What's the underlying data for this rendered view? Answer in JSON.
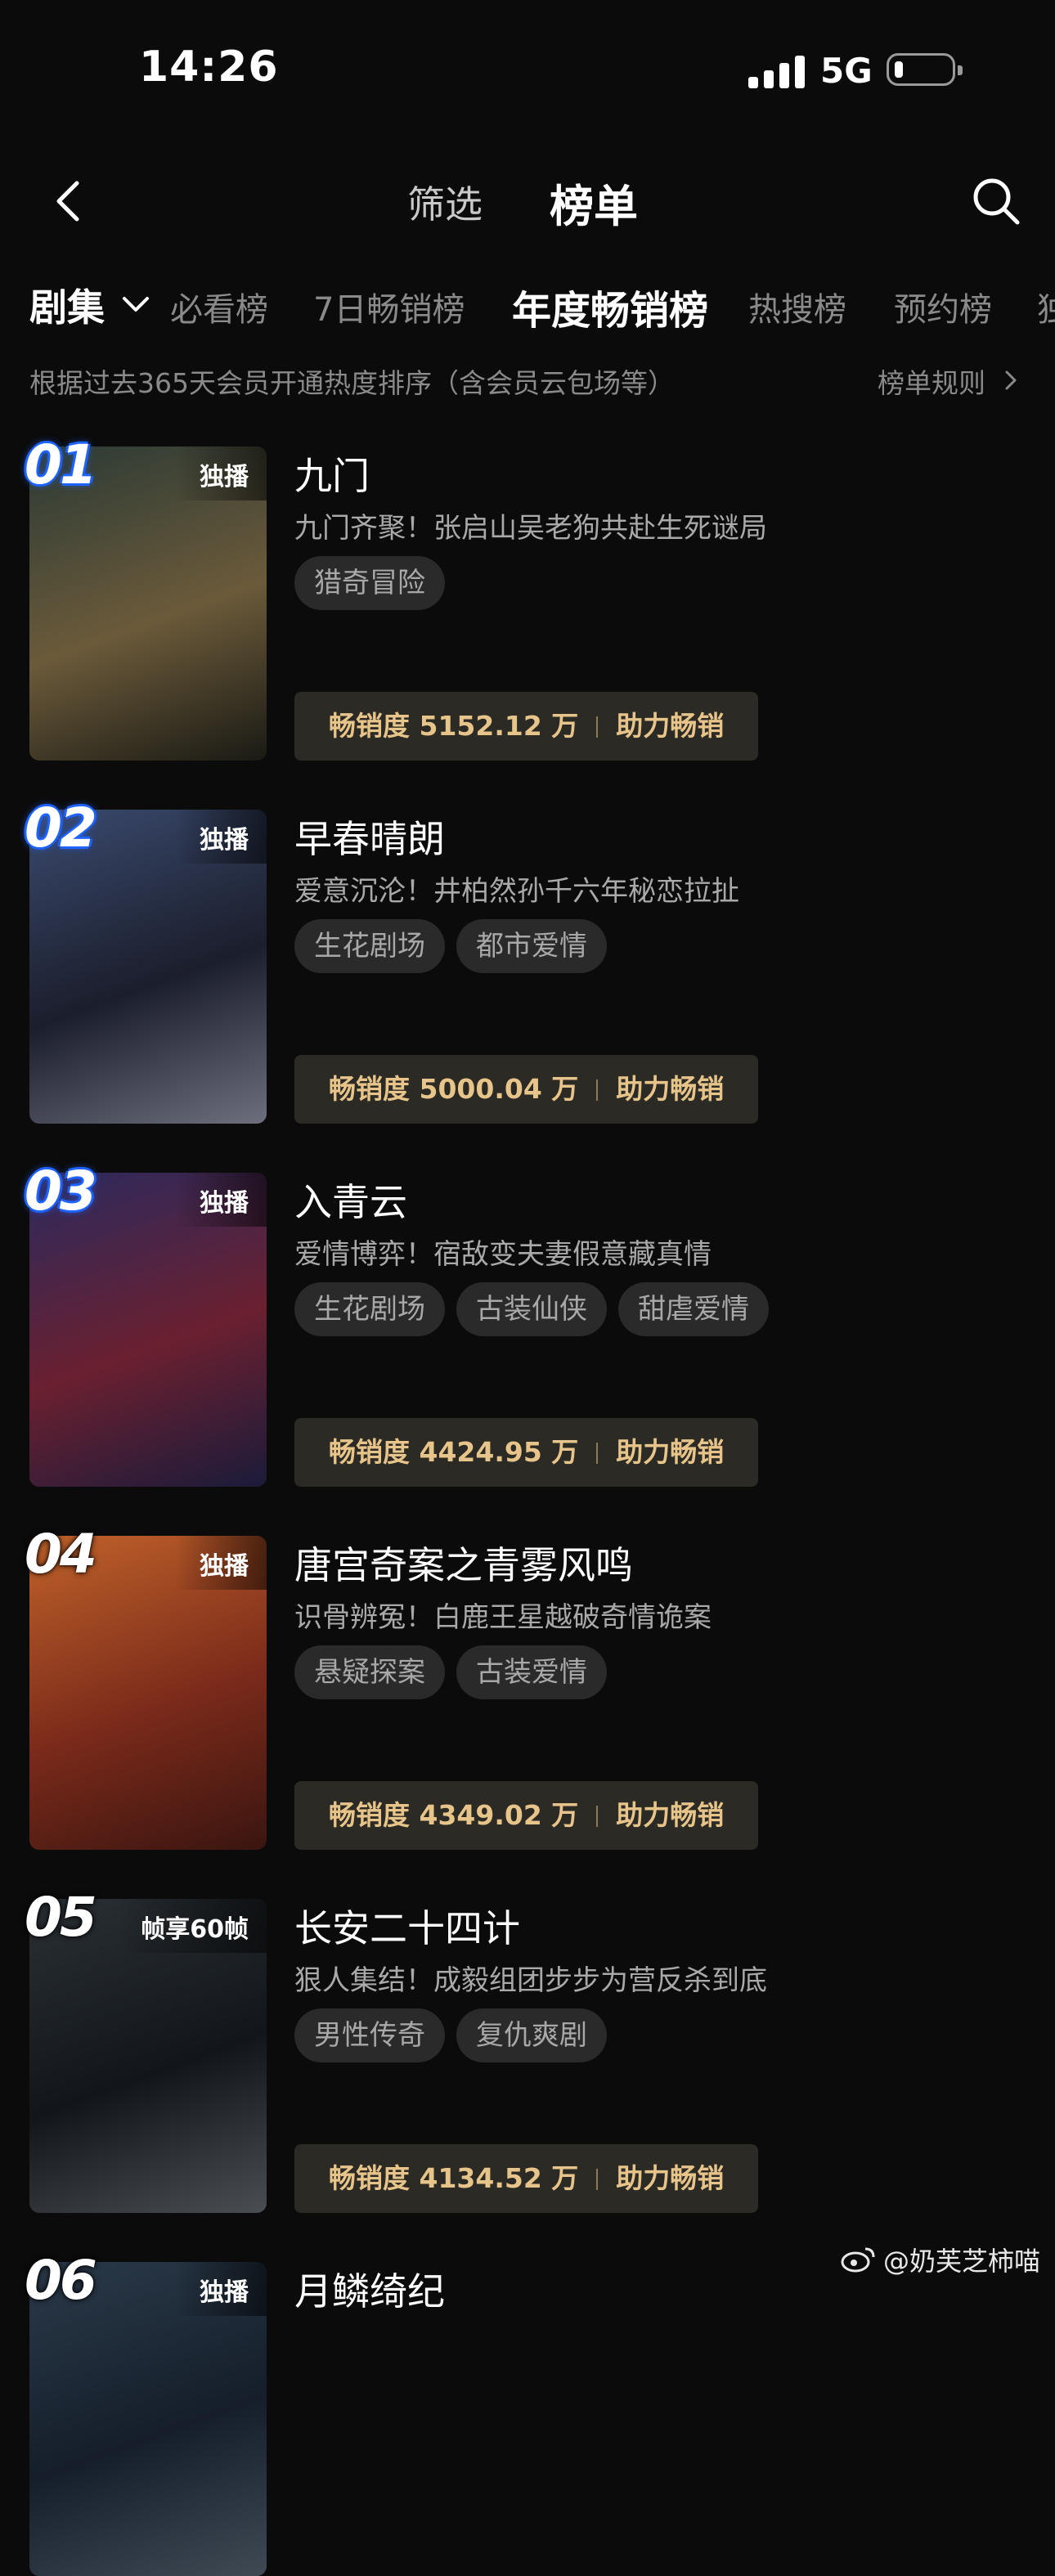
{
  "status_bar": {
    "time": "14:26",
    "network": "5G",
    "battery_level": 0.15
  },
  "navbar": {
    "filter_label": "筛选",
    "rank_label": "榜单"
  },
  "tabs": {
    "category": "剧集",
    "items": [
      "必看榜",
      "7日畅销榜",
      "年度畅销榜",
      "热搜榜",
      "预约榜",
      "独"
    ],
    "active_index": 2
  },
  "description": "根据过去365天会员开通热度排序（含会员云包场等）",
  "rules_label": "榜单规则",
  "list": [
    {
      "rank": "01",
      "badge": "独播",
      "title": "九门",
      "subtitle": "九门齐聚！张启山吴老狗共赴生死谜局",
      "tags": [
        "猎奇冒险"
      ],
      "sales": "畅销度 5152.12 万",
      "boost": "助力畅销",
      "poster_colors": [
        "#2b3a35",
        "#6b5a3a",
        "#1a1a14"
      ]
    },
    {
      "rank": "02",
      "badge": "独播",
      "title": "早春晴朗",
      "subtitle": "爱意沉沦！井柏然孙千六年秘恋拉扯",
      "tags": [
        "生花剧场",
        "都市爱情"
      ],
      "sales": "畅销度 5000.04 万",
      "boost": "助力畅销",
      "poster_colors": [
        "#3a4a6e",
        "#1b1e2c",
        "#6d6f7e"
      ]
    },
    {
      "rank": "03",
      "badge": "独播",
      "title": "入青云",
      "subtitle": "爱情博弈！宿敌变夫妻假意藏真情",
      "tags": [
        "生花剧场",
        "古装仙侠",
        "甜虐爱情"
      ],
      "sales": "畅销度 4424.95 万",
      "boost": "助力畅销",
      "poster_colors": [
        "#2b2a5e",
        "#6a2030",
        "#1b1b3a"
      ]
    },
    {
      "rank": "04",
      "badge": "独播",
      "title": "唐宫奇案之青雾风鸣",
      "subtitle": "识骨辨冤！白鹿王星越破奇情诡案",
      "tags": [
        "悬疑探案",
        "古装爱情"
      ],
      "sales": "畅销度 4349.02 万",
      "boost": "助力畅销",
      "poster_colors": [
        "#c0622a",
        "#7a2a1a",
        "#3a1510"
      ]
    },
    {
      "rank": "05",
      "badge": "帧享60帧",
      "title": "长安二十四计",
      "subtitle": "狠人集结！成毅组团步步为营反杀到底",
      "tags": [
        "男性传奇",
        "复仇爽剧"
      ],
      "sales": "畅销度 4134.52 万",
      "boost": "助力畅销",
      "poster_colors": [
        "#2a3035",
        "#12161a",
        "#4a4e52"
      ]
    },
    {
      "rank": "06",
      "badge": "独播",
      "title": "月鳞绮纪",
      "subtitle": "",
      "tags": [],
      "sales": "",
      "boost": "",
      "poster_colors": [
        "#2a3a4a",
        "#151e2a",
        "#404a55"
      ]
    }
  ],
  "watermark": "@奶芙芝柿喵"
}
